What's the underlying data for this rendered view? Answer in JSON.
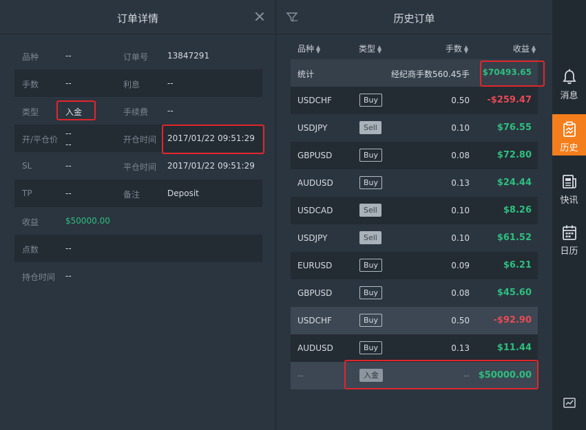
{
  "left_panel": {
    "title": "订单详情",
    "rows": [
      {
        "l1": "品种",
        "v1": "--",
        "l2": "订单号",
        "v2": "13847291"
      },
      {
        "l1": "手数",
        "v1": "--",
        "l2": "利息",
        "v2": "--"
      },
      {
        "l1": "类型",
        "v1": "入金",
        "l2": "手续费",
        "v2": "--"
      },
      {
        "l1": "开/平仓价",
        "v1a": "--",
        "v1b": "--",
        "l2": "开仓时间",
        "v2": "2017/01/22 09:51:29"
      },
      {
        "l1": "SL",
        "v1": "--",
        "l2": "平仓时间",
        "v2": "2017/01/22 09:51:29"
      },
      {
        "l1": "TP",
        "v1": "--",
        "l2": "备注",
        "v2": "Deposit"
      },
      {
        "l1": "收益",
        "v1": "$50000.00"
      },
      {
        "l1": "点数",
        "v1": "--"
      },
      {
        "l1": "持仓时间",
        "v1": "--"
      }
    ]
  },
  "right_panel": {
    "title": "历史订单",
    "headers": {
      "symbol": "品种",
      "type": "类型",
      "lots": "手数",
      "profit": "收益"
    },
    "summary": {
      "label": "统计",
      "commission": "经纪商手数560.45手",
      "total": "$70493.65"
    },
    "rows": [
      {
        "symbol": "USDCHF",
        "type": "Buy",
        "lots": "0.50",
        "profit": "-$259.47"
      },
      {
        "symbol": "USDJPY",
        "type": "Sell",
        "lots": "0.10",
        "profit": "$76.55"
      },
      {
        "symbol": "GBPUSD",
        "type": "Buy",
        "lots": "0.08",
        "profit": "$72.80"
      },
      {
        "symbol": "AUDUSD",
        "type": "Buy",
        "lots": "0.13",
        "profit": "$24.44"
      },
      {
        "symbol": "USDCAD",
        "type": "Sell",
        "lots": "0.10",
        "profit": "$8.26"
      },
      {
        "symbol": "USDJPY",
        "type": "Sell",
        "lots": "0.10",
        "profit": "$61.52"
      },
      {
        "symbol": "EURUSD",
        "type": "Buy",
        "lots": "0.09",
        "profit": "$6.21"
      },
      {
        "symbol": "GBPUSD",
        "type": "Buy",
        "lots": "0.08",
        "profit": "$45.60"
      },
      {
        "symbol": "USDCHF",
        "type": "Buy",
        "lots": "0.50",
        "profit": "-$92.90"
      },
      {
        "symbol": "AUDUSD",
        "type": "Buy",
        "lots": "0.13",
        "profit": "$11.44"
      },
      {
        "symbol": "--",
        "type": "入金",
        "lots": "--",
        "profit": "$50000.00"
      }
    ]
  },
  "sidebar": {
    "items": [
      {
        "label": "消息",
        "icon": "bell-icon"
      },
      {
        "label": "历史",
        "icon": "history-icon",
        "active": true
      },
      {
        "label": "快讯",
        "icon": "news-icon"
      },
      {
        "label": "日历",
        "icon": "calendar-icon"
      }
    ],
    "bottom_icon": "chart-icon"
  },
  "colors": {
    "accent": "#f57e1c",
    "positive": "#2ebf7e",
    "negative": "#e74a55",
    "highlight_box": "#e3262a"
  }
}
